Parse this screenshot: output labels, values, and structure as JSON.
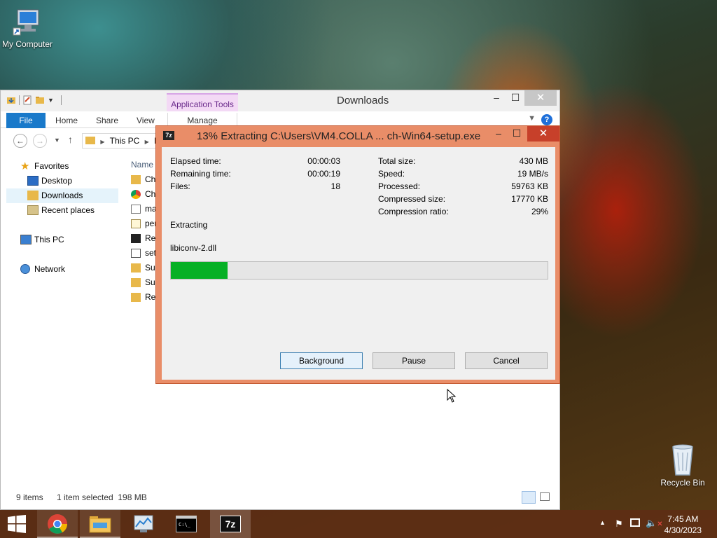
{
  "desktop": {
    "my_computer_label": "My Computer",
    "recycle_bin_label": "Recycle Bin"
  },
  "explorer": {
    "title": "Downloads",
    "context_tab": "Application Tools",
    "ribbon_tabs": [
      "File",
      "Home",
      "Share",
      "View",
      "Manage"
    ],
    "breadcrumb": [
      "This PC",
      "D"
    ],
    "nav_items": [
      {
        "label": "Favorites",
        "icon": "star-icon"
      },
      {
        "label": "Desktop",
        "icon": "desktop-icon"
      },
      {
        "label": "Downloads",
        "icon": "downloads-folder-icon",
        "selected": true
      },
      {
        "label": "Recent places",
        "icon": "recent-places-icon"
      },
      {
        "label": "This PC",
        "icon": "computer-icon"
      },
      {
        "label": "Network",
        "icon": "network-icon"
      }
    ],
    "column_header": "Name",
    "files": [
      {
        "name": "Ch",
        "icon": "folder-icon"
      },
      {
        "name": "Ch",
        "icon": "chrome-icon"
      },
      {
        "name": "ma",
        "icon": "image-file-icon"
      },
      {
        "name": "per",
        "icon": "certificate-icon"
      },
      {
        "name": "Ret",
        "icon": "app-icon"
      },
      {
        "name": "set",
        "icon": "setup-file-icon"
      },
      {
        "name": "Sup",
        "icon": "folder-icon"
      },
      {
        "name": "Sup",
        "icon": "folder-icon"
      },
      {
        "name": "Ret",
        "icon": "folder-icon"
      }
    ],
    "status": {
      "items": "9 items",
      "selection": "1 item selected  198 MB"
    }
  },
  "dialog": {
    "title": "13% Extracting C:\\Users\\VM4.COLLA ... ch-Win64-setup.exe",
    "left_stats": [
      {
        "label": "Elapsed time:",
        "value": "00:00:03"
      },
      {
        "label": "Remaining time:",
        "value": "00:00:19"
      },
      {
        "label": "Files:",
        "value": "18"
      }
    ],
    "right_stats": [
      {
        "label": "Total size:",
        "value": "430 MB"
      },
      {
        "label": "Speed:",
        "value": "19 MB/s"
      },
      {
        "label": "Processed:",
        "value": "59763 KB"
      },
      {
        "label": "Compressed size:",
        "value": "17770 KB"
      },
      {
        "label": "Compression ratio:",
        "value": "29%"
      }
    ],
    "action": "Extracting",
    "current_file": "libiconv-2.dll",
    "progress_fraction": 0.15,
    "buttons": {
      "background": "Background",
      "pause": "Pause",
      "cancel": "Cancel"
    },
    "accent_color": "#e98d68",
    "progress_color": "#06b025"
  },
  "taskbar": {
    "apps": [
      "chrome-icon",
      "file-explorer-icon",
      "performance-monitor-icon",
      "command-prompt-icon",
      "7zip-icon"
    ],
    "time": "7:45 AM",
    "date": "4/30/2023"
  }
}
